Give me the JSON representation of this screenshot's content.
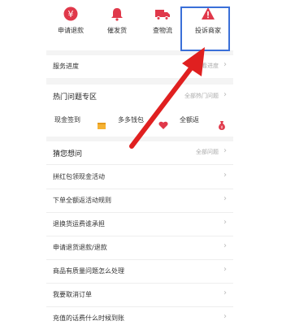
{
  "quick_actions": [
    {
      "label": "申请退款",
      "icon": "yen-icon"
    },
    {
      "label": "催发货",
      "icon": "bell-icon"
    },
    {
      "label": "查物流",
      "icon": "truck-icon"
    },
    {
      "label": "投诉商家",
      "icon": "warning-icon"
    }
  ],
  "service_progress": {
    "label": "服务进度",
    "sub": "查看进度"
  },
  "hot": {
    "title": "热门问题专区",
    "more": "全部热门问题",
    "items": [
      {
        "label": "现金签到",
        "icon": "gift-box-icon"
      },
      {
        "label": "多多钱包",
        "icon": "heart-icon"
      },
      {
        "label": "全额返",
        "icon": "money-bag-icon"
      }
    ]
  },
  "guess": {
    "title": "猜您想问",
    "more": "全部问题",
    "items": [
      "拼红包领现金活动",
      "下单全额返活动规则",
      "退换货运费谁承担",
      "申请退货退款/退款",
      "商品有质量问题怎么处理",
      "我要取消订单",
      "充值的话费什么时候到账"
    ]
  },
  "colors": {
    "accent": "#e0384a",
    "highlight": "#3a6fd8",
    "arrow": "#e02020"
  }
}
